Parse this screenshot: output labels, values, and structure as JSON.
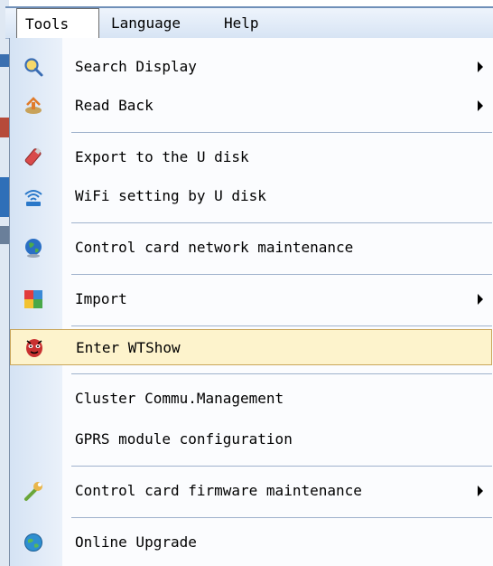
{
  "menubar": {
    "items": [
      {
        "label": "Tools"
      },
      {
        "label": "Language"
      },
      {
        "label": "Help"
      }
    ]
  },
  "menu": {
    "items": [
      {
        "label": "Search Display",
        "icon": "magnifier-icon",
        "submenu": true
      },
      {
        "label": "Read Back",
        "icon": "read-back-icon",
        "submenu": true
      },
      {
        "label": "Export to the U disk",
        "icon": "usb-disk-icon",
        "submenu": false
      },
      {
        "label": "WiFi setting by U disk",
        "icon": "wifi-icon",
        "submenu": false
      },
      {
        "label": "Control card network maintenance",
        "icon": "globe-icon",
        "submenu": false
      },
      {
        "label": "Import",
        "icon": "import-icon",
        "submenu": true
      },
      {
        "label": "Enter WTShow",
        "icon": "mask-icon",
        "submenu": false,
        "highlighted": true
      },
      {
        "label": "Cluster Commu.Management",
        "icon": "",
        "submenu": false
      },
      {
        "label": "GPRS module configuration",
        "icon": "",
        "submenu": false
      },
      {
        "label": "Control card firmware maintenance",
        "icon": "wrench-icon",
        "submenu": true
      },
      {
        "label": "Online Upgrade",
        "icon": "update-globe-icon",
        "submenu": false
      }
    ]
  },
  "colors": {
    "highlight": "#fdf3cc",
    "highlight_border": "#c9a65a",
    "gutter": "#d5e3f4"
  }
}
